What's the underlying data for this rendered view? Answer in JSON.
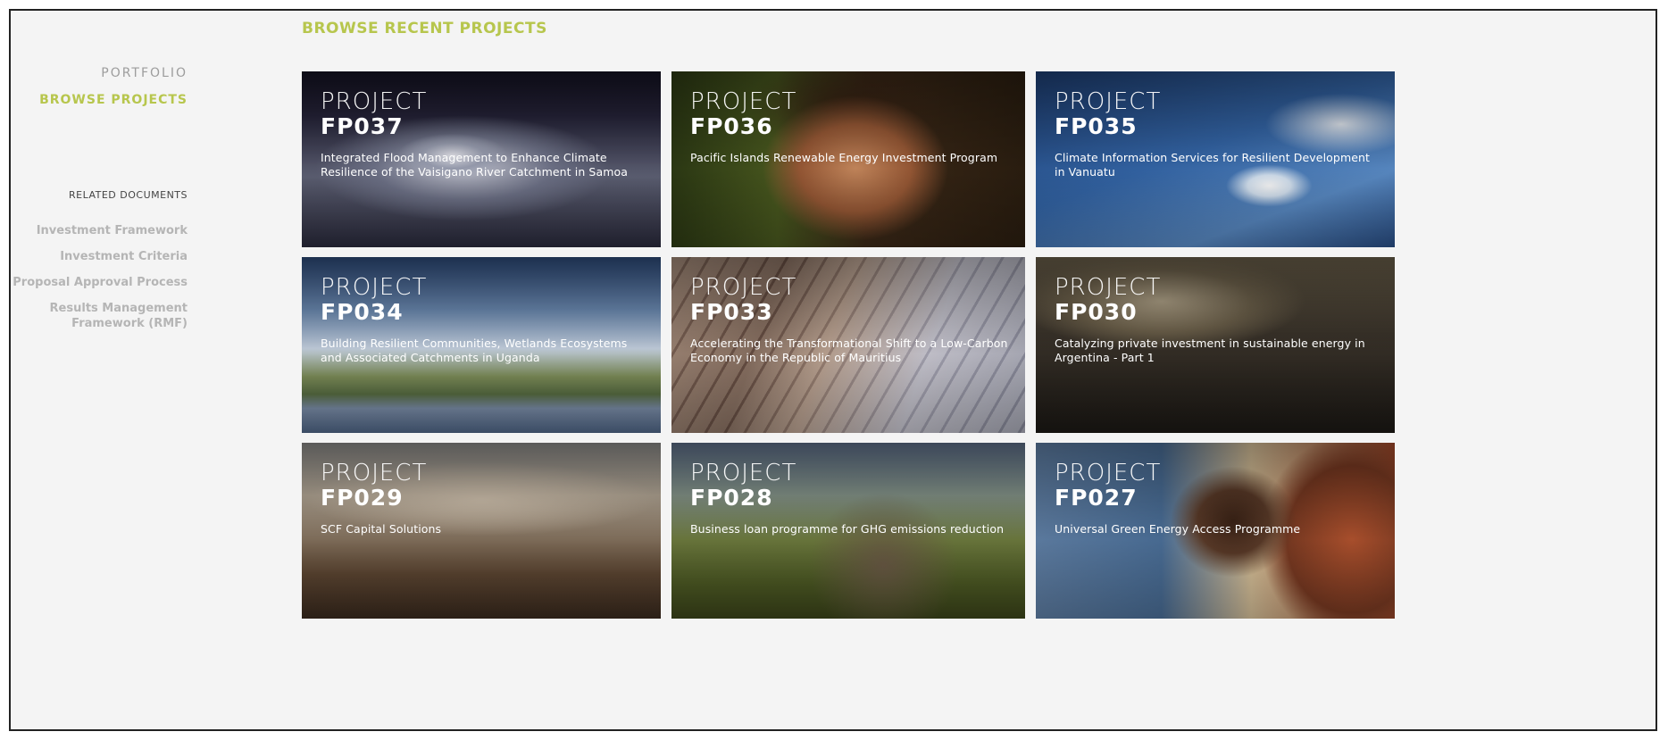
{
  "page_title": "BROWSE RECENT PROJECTS",
  "sidebar": {
    "portfolio": "PORTFOLIO",
    "browse_projects": "BROWSE PROJECTS",
    "related_heading": "RELATED DOCUMENTS",
    "documents": [
      {
        "label": "Investment Framework"
      },
      {
        "label": "Investment Criteria"
      },
      {
        "label": "Proposal Approval Process"
      },
      {
        "label": "Results Management Framework (RMF)"
      }
    ]
  },
  "project_word": "PROJECT",
  "projects": [
    {
      "id": "FP037",
      "title": "Integrated Flood Management to Enhance Climate Resilience of the Vaisigano River Catchment in Samoa"
    },
    {
      "id": "FP036",
      "title": "Pacific Islands Renewable Energy Investment Program"
    },
    {
      "id": "FP035",
      "title": "Climate Information Services for Resilient Development in Vanuatu"
    },
    {
      "id": "FP034",
      "title": "Building Resilient Communities, Wetlands Ecosystems and Associated Catchments in Uganda"
    },
    {
      "id": "FP033",
      "title": "Accelerating the Transformational Shift to a Low-Carbon Economy in the Republic of Mauritius"
    },
    {
      "id": "FP030",
      "title": "Catalyzing private investment in sustainable energy in Argentina - Part 1"
    },
    {
      "id": "FP029",
      "title": "SCF Capital Solutions"
    },
    {
      "id": "FP028",
      "title": "Business loan programme for GHG emissions reduction"
    },
    {
      "id": "FP027",
      "title": "Universal Green Energy Access Programme"
    }
  ],
  "colors": {
    "accent": "#b7c64d",
    "muted_link": "#b5b5b5",
    "background": "#f4f4f4"
  }
}
